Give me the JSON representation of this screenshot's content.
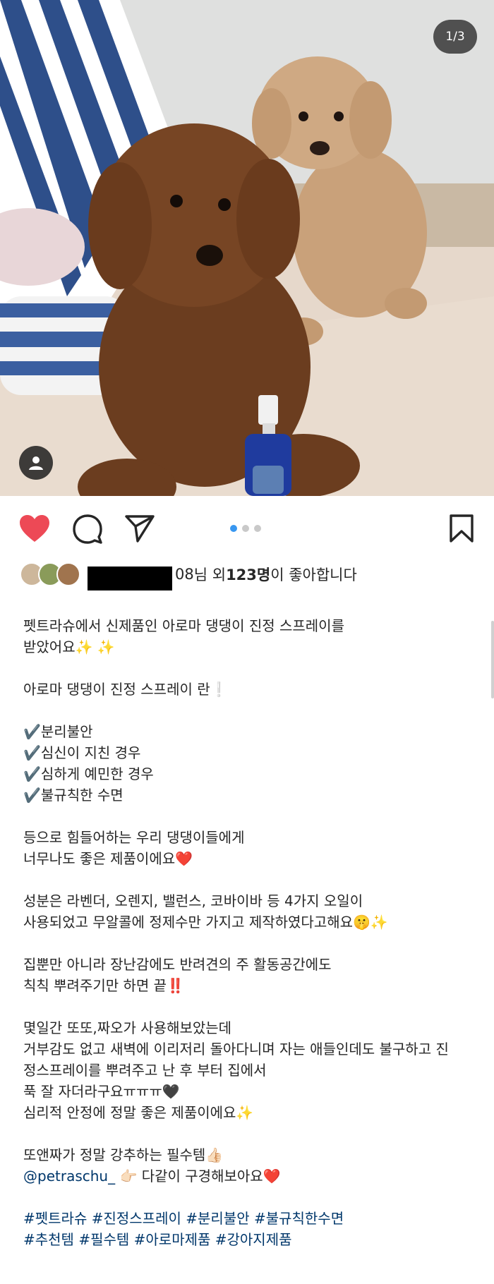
{
  "photo": {
    "counter": "1/3",
    "alt_subject": "two poodles with a spray bottle"
  },
  "actions": {
    "like_icon": "heart-filled-icon",
    "comment_icon": "comment-icon",
    "share_icon": "send-icon",
    "save_icon": "bookmark-icon",
    "carousel_total": 3,
    "carousel_index": 1,
    "accent_heart": "#ed4956",
    "accent_dot": "#3897f0"
  },
  "likes": {
    "redacted_suffix": "08",
    "liked_by_text": "님 외 ",
    "count": "123명",
    "suffix": "이 좋아합니다"
  },
  "caption": {
    "lines": [
      "펫트라슈에서 신제품인 아로마 댕댕이 진정 스프레이를",
      "받았어요✨ ✨",
      "",
      "아로마 댕댕이 진정 스프레이 란❕",
      "",
      "✔️분리불안",
      "✔️심신이 지친 경우",
      "✔️심하게 예민한 경우",
      "✔️불규칙한 수면",
      "",
      "등으로 힘들어하는 우리 댕댕이들에게",
      "너무나도 좋은 제품이에요❤️",
      "",
      "성분은 라벤더, 오렌지, 밸런스, 코바이바 등 4가지 오일이",
      "사용되었고 무알콜에 정제수만 가지고 제작하였다고해요🤫✨",
      "",
      "집뿐만 아니라 장난감에도 반려견의 주 활동공간에도",
      "칙칙 뿌려주기만 하면 끝‼️",
      "",
      "몇일간 또또,짜오가 사용해보았는데",
      "거부감도 없고 새벽에 이리저리 돌아다니며 자는 애들인데도 불구하고 진",
      "정스프레이를 뿌려주고 난 후 부터 집에서",
      "푹 잘 자더라구요ㅠㅠㅠ🖤",
      "심리적 안정에 정말 좋은 제품이에요✨",
      "",
      "또앤짜가 정말 강추하는 필수템👍🏻"
    ],
    "mention": "@petraschu_",
    "mention_suffix": " 👉🏻 다같이 구경해보아요❤️",
    "hashtags_line1": "#펫트라슈 #진정스프레이 #분리불안 #불규칙한수면",
    "hashtags_line2": "#추천템 #필수템 #아로마제품 #강아지제품"
  }
}
